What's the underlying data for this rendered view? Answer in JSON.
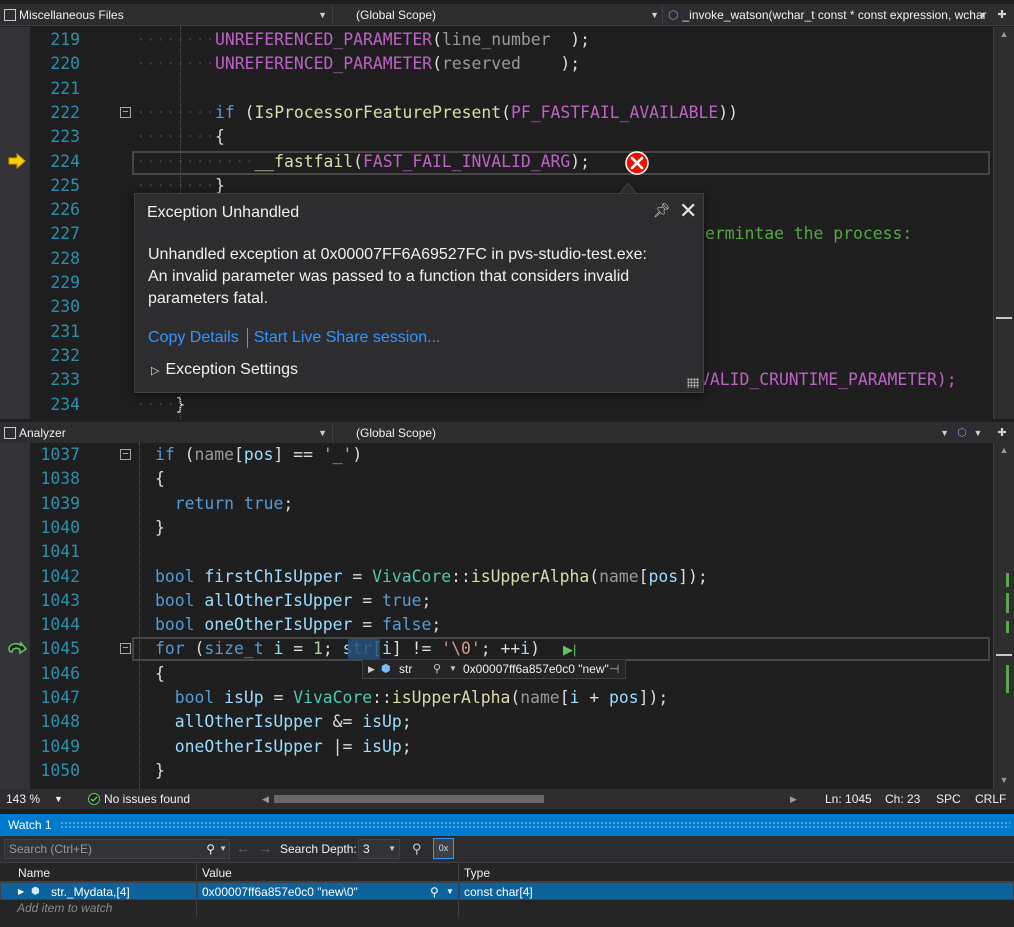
{
  "top_nav": {
    "project": "Miscellaneous Files",
    "scope": "(Global Scope)",
    "member": "_invoke_watson(wchar_t const * const expression, wchar"
  },
  "top_code": {
    "lines": [
      {
        "n": "219",
        "pre": "        ",
        "parts": [
          [
            "mac",
            "UNREFERENCED_PARAMETER"
          ],
          [
            "",
            "("
          ],
          [
            "par",
            "line_number"
          ],
          [
            "",
            "  );"
          ]
        ]
      },
      {
        "n": "220",
        "pre": "        ",
        "parts": [
          [
            "mac",
            "UNREFERENCED_PARAMETER"
          ],
          [
            "",
            "("
          ],
          [
            "par",
            "reserved"
          ],
          [
            "",
            "    );"
          ]
        ]
      },
      {
        "n": "221",
        "pre": "",
        "parts": []
      },
      {
        "n": "222",
        "pre": "        ",
        "parts": [
          [
            "kw",
            "if"
          ],
          [
            "",
            " ("
          ],
          [
            "fn",
            "IsProcessorFeaturePresent"
          ],
          [
            "",
            "("
          ],
          [
            "mac",
            "PF_FASTFAIL_AVAILABLE"
          ],
          [
            "",
            "))"
          ]
        ]
      },
      {
        "n": "223",
        "pre": "        ",
        "parts": [
          [
            "",
            "{"
          ]
        ]
      },
      {
        "n": "224",
        "pre": "            ",
        "parts": [
          [
            "fn",
            "__fastfail"
          ],
          [
            "",
            "("
          ],
          [
            "mac",
            "FAST_FAIL_INVALID_ARG"
          ],
          [
            "",
            ");"
          ]
        ]
      },
      {
        "n": "225",
        "pre": "        ",
        "parts": [
          [
            "",
            "}"
          ]
        ]
      },
      {
        "n": "226",
        "pre": "",
        "parts": []
      },
      {
        "n": "227",
        "pre": "",
        "parts": []
      },
      {
        "n": "228",
        "pre": "",
        "parts": []
      },
      {
        "n": "229",
        "pre": "",
        "parts": []
      },
      {
        "n": "230",
        "pre": "",
        "parts": []
      },
      {
        "n": "231",
        "pre": "",
        "parts": []
      },
      {
        "n": "232",
        "pre": "",
        "parts": []
      },
      {
        "n": "233",
        "pre": "",
        "parts": []
      },
      {
        "n": "234",
        "pre": "    ",
        "parts": [
          [
            "",
            "}"
          ]
        ]
      }
    ],
    "comment_fragment": "ermintae the process:",
    "line233_fragment": "VALID_CRUNTIME_PARAMETER);"
  },
  "exception": {
    "title": "Exception Unhandled",
    "message_lines": [
      "Unhandled exception at 0x00007FF6A69527FC in pvs-studio-test.exe:",
      "An invalid parameter was passed to a function that considers invalid",
      "parameters fatal."
    ],
    "copy_details": "Copy Details",
    "live_share": "Start Live Share session...",
    "settings": "Exception Settings"
  },
  "bottom_nav": {
    "project": "Analyzer",
    "scope": "(Global Scope)"
  },
  "bottom_code": {
    "lines": [
      {
        "n": "1037",
        "parts": [
          [
            "kw",
            "if"
          ],
          [
            "",
            " ("
          ],
          [
            "par",
            "name"
          ],
          [
            "",
            "["
          ],
          [
            "var",
            "pos"
          ],
          [
            "",
            "] == "
          ],
          [
            "str",
            "'_'"
          ],
          [
            "",
            ")"
          ]
        ]
      },
      {
        "n": "1038",
        "parts": [
          [
            "",
            "{"
          ]
        ]
      },
      {
        "n": "1039",
        "parts": [
          [
            "",
            "  "
          ],
          [
            "kw",
            "return"
          ],
          [
            "",
            " "
          ],
          [
            "kw",
            "true"
          ],
          [
            "",
            ";"
          ]
        ]
      },
      {
        "n": "1040",
        "parts": [
          [
            "",
            "}"
          ]
        ]
      },
      {
        "n": "1041",
        "parts": []
      },
      {
        "n": "1042",
        "parts": [
          [
            "kw",
            "bool"
          ],
          [
            "",
            " "
          ],
          [
            "var",
            "firstChIsUpper"
          ],
          [
            "",
            " = "
          ],
          [
            "ty",
            "VivaCore"
          ],
          [
            "",
            "::"
          ],
          [
            "fn",
            "isUpperAlpha"
          ],
          [
            "",
            "("
          ],
          [
            "par",
            "name"
          ],
          [
            "",
            "["
          ],
          [
            "var",
            "pos"
          ],
          [
            "",
            "]);"
          ]
        ]
      },
      {
        "n": "1043",
        "parts": [
          [
            "kw",
            "bool"
          ],
          [
            "",
            " "
          ],
          [
            "var",
            "allOtherIsUpper"
          ],
          [
            "",
            " = "
          ],
          [
            "kw",
            "true"
          ],
          [
            "",
            ";"
          ]
        ]
      },
      {
        "n": "1044",
        "parts": [
          [
            "kw",
            "bool"
          ],
          [
            "",
            " "
          ],
          [
            "var",
            "oneOtherIsUpper"
          ],
          [
            "",
            " = "
          ],
          [
            "kw",
            "false"
          ],
          [
            "",
            ";"
          ]
        ]
      },
      {
        "n": "1045",
        "parts": [
          [
            "kw",
            "for"
          ],
          [
            "",
            " ("
          ],
          [
            "kw",
            "size_t"
          ],
          [
            "",
            " "
          ],
          [
            "var",
            "i"
          ],
          [
            "",
            " = "
          ],
          [
            "num",
            "1"
          ],
          [
            "",
            "; "
          ],
          [
            "var",
            "str"
          ],
          [
            "",
            "["
          ],
          [
            "var",
            "i"
          ],
          [
            "",
            "] != "
          ],
          [
            "str",
            "'\\0'"
          ],
          [
            "",
            "; ++"
          ],
          [
            "var",
            "i"
          ],
          [
            "",
            ")"
          ]
        ]
      },
      {
        "n": "1046",
        "parts": [
          [
            "",
            "{"
          ]
        ]
      },
      {
        "n": "1047",
        "parts": [
          [
            "",
            "  "
          ],
          [
            "kw",
            "bool"
          ],
          [
            "",
            " "
          ],
          [
            "var",
            "isUp"
          ],
          [
            "",
            " = "
          ],
          [
            "ty",
            "VivaCore"
          ],
          [
            "",
            "::"
          ],
          [
            "fn",
            "isUpperAlpha"
          ],
          [
            "",
            "("
          ],
          [
            "par",
            "name"
          ],
          [
            "",
            "["
          ],
          [
            "var",
            "i"
          ],
          [
            "",
            " + "
          ],
          [
            "var",
            "pos"
          ],
          [
            "",
            "]);"
          ]
        ]
      },
      {
        "n": "1048",
        "parts": [
          [
            "",
            "  "
          ],
          [
            "var",
            "allOtherIsUpper"
          ],
          [
            "",
            " &= "
          ],
          [
            "var",
            "isUp"
          ],
          [
            "",
            ";"
          ]
        ]
      },
      {
        "n": "1049",
        "parts": [
          [
            "",
            "  "
          ],
          [
            "var",
            "oneOtherIsUpper"
          ],
          [
            "",
            " |= "
          ],
          [
            "var",
            "isUp"
          ],
          [
            "",
            ";"
          ]
        ]
      },
      {
        "n": "1050",
        "parts": [
          [
            "",
            "}"
          ]
        ]
      }
    ]
  },
  "datatip": {
    "name": "str",
    "value": "0x00007ff6a857e0c0 \"new\""
  },
  "editor_status": {
    "zoom": "143 %",
    "issues": "No issues found",
    "ln": "Ln: 1045",
    "ch": "Ch: 23",
    "spc": "SPC",
    "crlf": "CRLF"
  },
  "watch": {
    "title": "Watch 1",
    "search_placeholder": "Search (Ctrl+E)",
    "search_depth_label": "Search Depth:",
    "search_depth_value": "3",
    "columns": {
      "name": "Name",
      "value": "Value",
      "type": "Type"
    },
    "row": {
      "name": "str._Mydata,[4]",
      "value": "0x00007ff6a857e0c0 \"new\\0\"",
      "type": "const char[4]"
    },
    "add_item": "Add item to watch"
  },
  "colors": {
    "accent": "#007acc",
    "link": "#3794ff",
    "error": "#e51400",
    "keyword": "#569cd6"
  }
}
